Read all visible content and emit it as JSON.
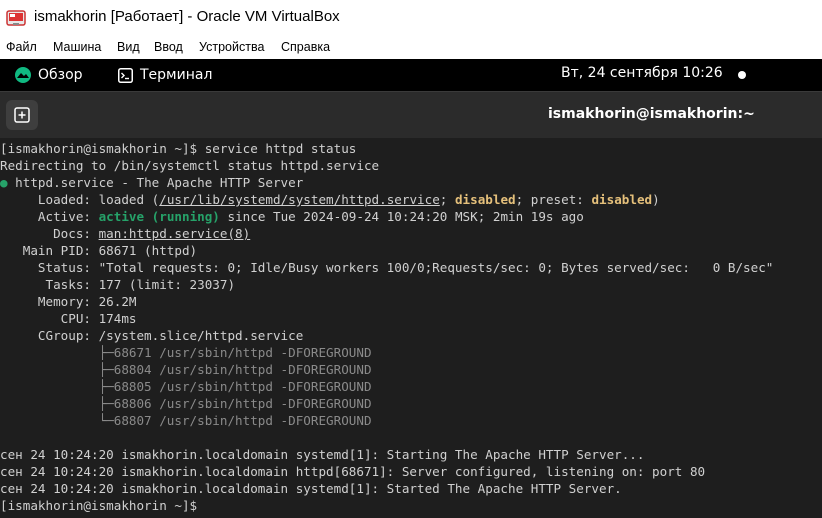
{
  "window": {
    "title": "ismakhorin [Работает] - Oracle VM VirtualBox"
  },
  "menubar": {
    "items": [
      "Файл",
      "Машина",
      "Вид",
      "Ввод",
      "Устройства",
      "Справка"
    ]
  },
  "topbar": {
    "overview_label": "Обзор",
    "app_label": "Терминал",
    "clock": "Вт, 24 сентября  10:26"
  },
  "terminal": {
    "title": "ismakhorin@ismakhorin:~",
    "prompt": "[ismakhorin@ismakhorin ~]$ ",
    "command": "service httpd status",
    "redirect": "Redirecting to /bin/systemctl status httpd.service",
    "service_bullet": "●",
    "service_line": " httpd.service - The Apache HTTP Server",
    "loaded": {
      "label": "     Loaded: ",
      "pre": "loaded (",
      "path": "/usr/lib/systemd/system/httpd.service",
      "mid": "; ",
      "state": "disabled",
      "preset_pre": "; preset: ",
      "preset": "disabled",
      "post": ")"
    },
    "active": {
      "label": "     Active: ",
      "state": "active (running)",
      "rest": " since Tue 2024-09-24 10:24:20 MSK; 2min 19s ago"
    },
    "docs": {
      "label": "       Docs: ",
      "value": "man:httpd.service(8)"
    },
    "main_pid": "   Main PID: 68671 (httpd)",
    "status_line": "     Status: \"Total requests: 0; Idle/Busy workers 100/0;Requests/sec: 0; Bytes served/sec:   0 B/sec\"",
    "tasks": "      Tasks: 177 (limit: 23037)",
    "memory": "     Memory: 26.2M",
    "cpu": "        CPU: 174ms",
    "cgroup": "     CGroup: /system.slice/httpd.service",
    "processes": [
      "             ├─68671 /usr/sbin/httpd -DFOREGROUND",
      "             ├─68804 /usr/sbin/httpd -DFOREGROUND",
      "             ├─68805 /usr/sbin/httpd -DFOREGROUND",
      "             ├─68806 /usr/sbin/httpd -DFOREGROUND",
      "             └─68807 /usr/sbin/httpd -DFOREGROUND"
    ],
    "logs": [
      "сен 24 10:24:20 ismakhorin.localdomain systemd[1]: Starting The Apache HTTP Server...",
      "сен 24 10:24:20 ismakhorin.localdomain httpd[68671]: Server configured, listening on: port 80",
      "сен 24 10:24:20 ismakhorin.localdomain systemd[1]: Started The Apache HTTP Server."
    ],
    "final_prompt": "[ismakhorin@ismakhorin ~]$ "
  }
}
